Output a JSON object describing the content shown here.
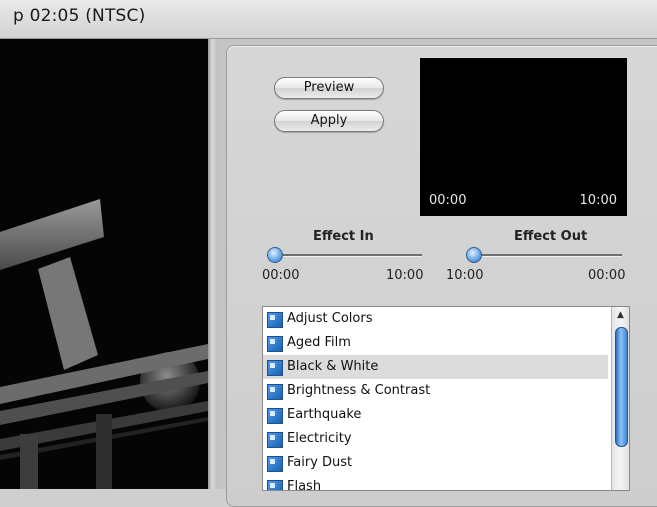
{
  "window": {
    "title": "p  02:05 (NTSC)"
  },
  "buttons": {
    "preview": "Preview",
    "apply": "Apply"
  },
  "preview": {
    "start_time": "00:00",
    "end_time": "10:00"
  },
  "effect_in": {
    "label": "Effect In",
    "start": "00:00",
    "end": "10:00",
    "level": 0.0
  },
  "effect_out": {
    "label": "Effect Out",
    "start": "10:00",
    "end": "00:00",
    "level": 0.0
  },
  "effects_list": {
    "items": [
      {
        "label": "Adjust Colors",
        "selected": false
      },
      {
        "label": "Aged Film",
        "selected": false
      },
      {
        "label": "Black & White",
        "selected": true
      },
      {
        "label": "Brightness & Contrast",
        "selected": false
      },
      {
        "label": "Earthquake",
        "selected": false
      },
      {
        "label": "Electricity",
        "selected": false
      },
      {
        "label": "Fairy Dust",
        "selected": false
      },
      {
        "label": "Flash",
        "selected": false
      }
    ]
  },
  "colors": {
    "accent": "#3f86d6",
    "selection": "#dcdcdc"
  }
}
